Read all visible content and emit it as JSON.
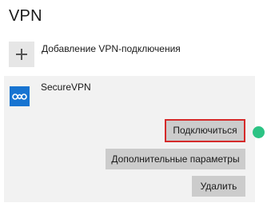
{
  "page": {
    "title": "VPN"
  },
  "add_connection": {
    "label": "Добавление VPN-подключения",
    "icon": "plus-icon"
  },
  "vpn_item": {
    "name": "SecureVPN",
    "icon": "vpn-connection-icon",
    "status_color": "#2cc384",
    "actions": {
      "connect": "Подключиться",
      "advanced": "Дополнительные параметры",
      "delete": "Удалить"
    }
  },
  "colors": {
    "accent": "#1874d1",
    "highlight_border": "#d52a2a",
    "button_bg": "#cccccc",
    "panel_bg": "#f2f2f2"
  }
}
